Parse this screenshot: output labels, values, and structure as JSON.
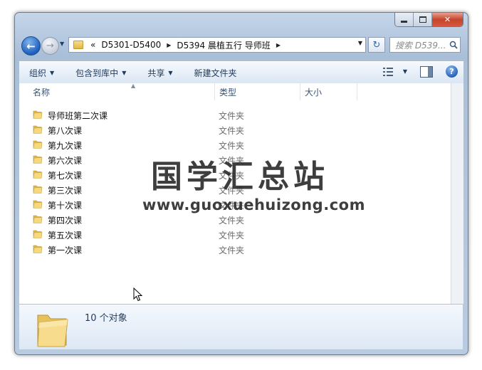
{
  "address": {
    "history_glyph": "«",
    "breadcrumbs": [
      "D5301-D5400",
      "D5394 晨植五行 导师班"
    ]
  },
  "search": {
    "placeholder": "搜索 D539..."
  },
  "toolbar": {
    "organize": "组织",
    "include_library": "包含到库中",
    "share": "共享",
    "new_folder": "新建文件夹"
  },
  "columns": {
    "name": "名称",
    "type": "类型",
    "size": "大小"
  },
  "files": [
    {
      "name": "导师班第二次课",
      "type": "文件夹"
    },
    {
      "name": "第八次课",
      "type": "文件夹"
    },
    {
      "name": "第九次课",
      "type": "文件夹"
    },
    {
      "name": "第六次课",
      "type": "文件夹"
    },
    {
      "name": "第七次课",
      "type": "文件夹"
    },
    {
      "name": "第三次课",
      "type": "文件夹"
    },
    {
      "name": "第十次课",
      "type": "文件夹"
    },
    {
      "name": "第四次课",
      "type": "文件夹"
    },
    {
      "name": "第五次课",
      "type": "文件夹"
    },
    {
      "name": "第一次课",
      "type": "文件夹"
    }
  ],
  "details": {
    "count_text": "10 个对象"
  },
  "watermark": {
    "title": "国学汇总站",
    "url": "www.guoxuehuizong.com"
  }
}
